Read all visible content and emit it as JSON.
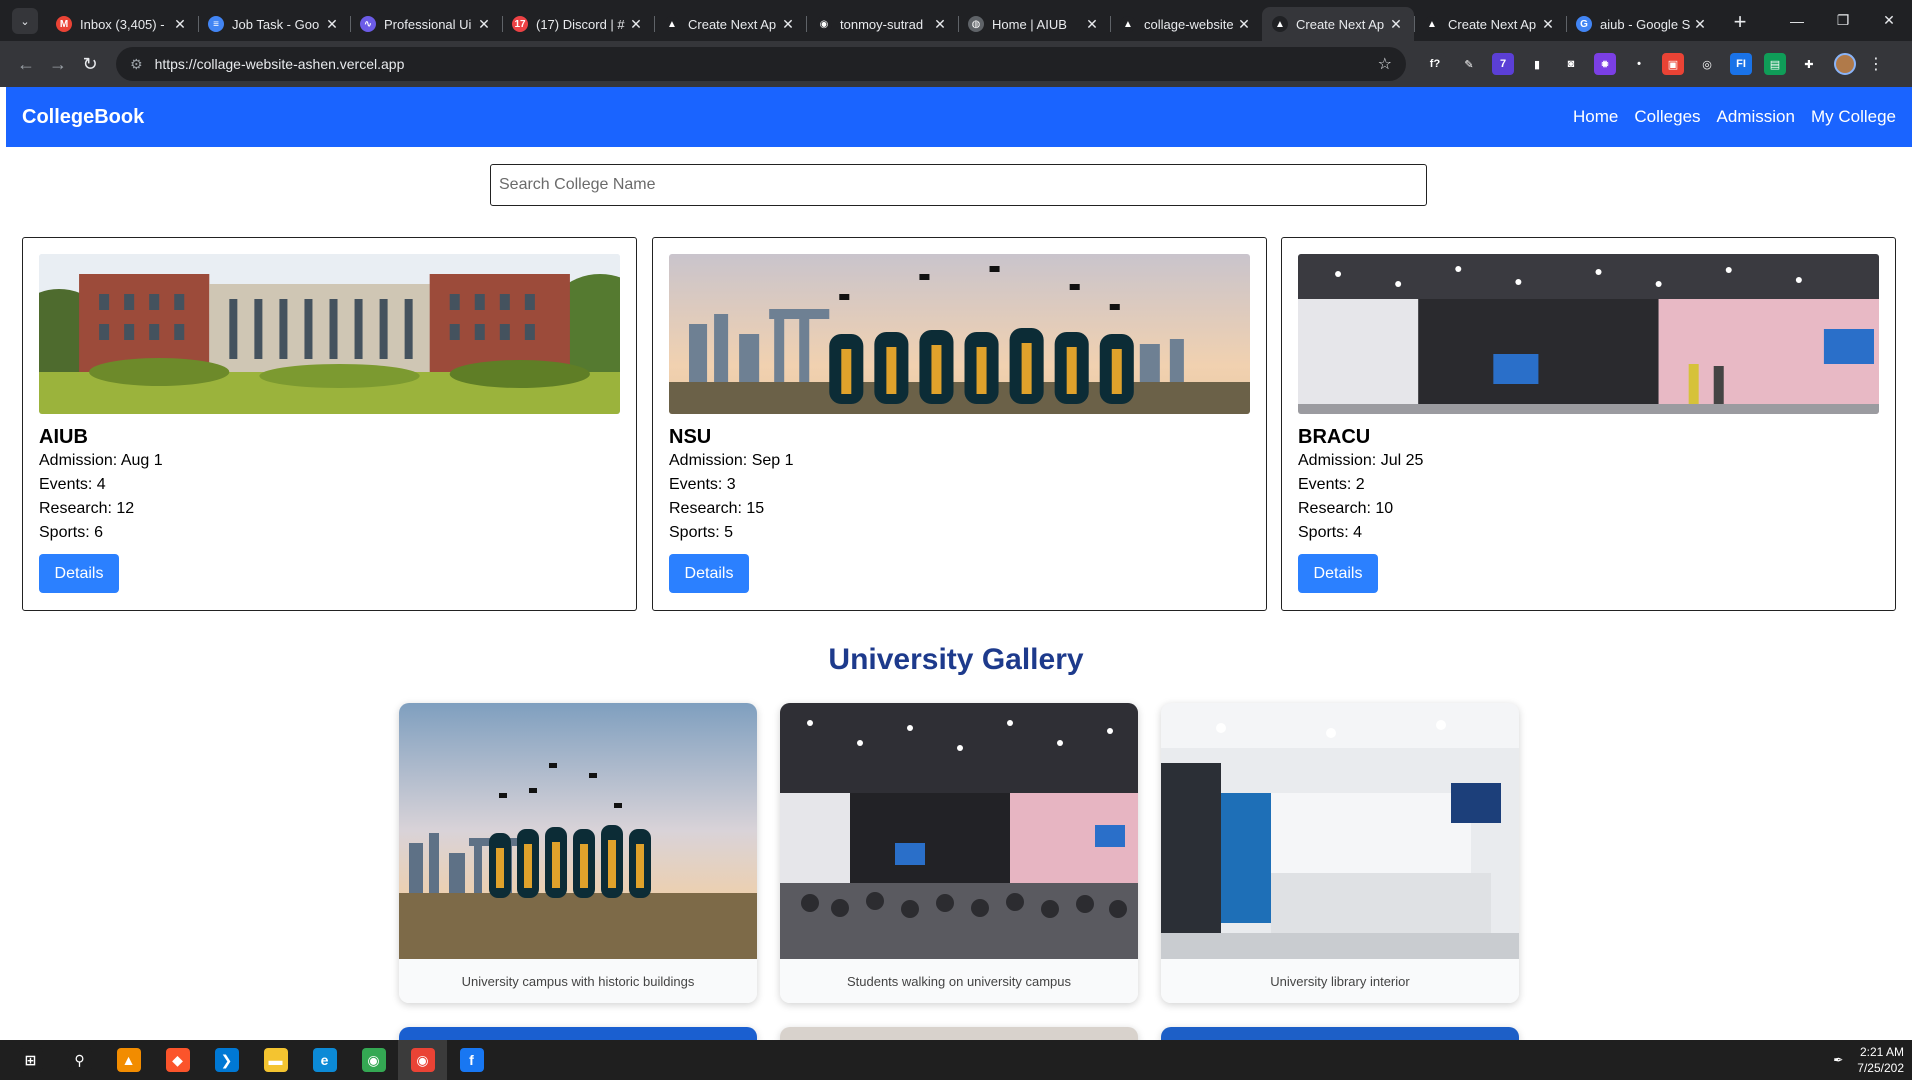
{
  "browser": {
    "tabs": [
      {
        "title": "Inbox (3,405) - ",
        "icon": "gmail-icon",
        "color": "#ea4335",
        "glyph": "M"
      },
      {
        "title": "Job Task - Goo",
        "icon": "docs-icon",
        "color": "#4285f4",
        "glyph": "≡"
      },
      {
        "title": "Professional Ui",
        "icon": "app-icon",
        "color": "#6c5ce7",
        "glyph": "∿"
      },
      {
        "title": "(17) Discord | #",
        "icon": "discord-icon",
        "color": "#ed4245",
        "glyph": "17"
      },
      {
        "title": "Create Next Ap",
        "icon": "vercel-icon",
        "color": "#202124",
        "glyph": "▲"
      },
      {
        "title": "tonmoy-sutrad",
        "icon": "github-icon",
        "color": "#202124",
        "glyph": "◉"
      },
      {
        "title": "Home | AIUB",
        "icon": "globe-icon",
        "color": "#5f6368",
        "glyph": "◍"
      },
      {
        "title": "collage-website",
        "icon": "vercel-icon",
        "color": "#202124",
        "glyph": "▲"
      },
      {
        "title": "Create Next Ap",
        "icon": "vercel-icon",
        "color": "#202124",
        "glyph": "▲",
        "active": true
      },
      {
        "title": "Create Next Ap",
        "icon": "vercel-icon",
        "color": "#202124",
        "glyph": "▲"
      },
      {
        "title": "aiub - Google S",
        "icon": "google-icon",
        "color": "#4285f4",
        "glyph": "G"
      }
    ],
    "url": "https://collage-website-ashen.vercel.app",
    "extensions": [
      {
        "icon": "font-icon",
        "color": "#35363a",
        "glyph": "f?"
      },
      {
        "icon": "eyedropper-icon",
        "color": "#35363a",
        "glyph": "✎"
      },
      {
        "icon": "extension-badge-icon",
        "color": "#5b3fd6",
        "glyph": "7"
      },
      {
        "icon": "note-icon",
        "color": "#35363a",
        "glyph": "▮"
      },
      {
        "icon": "camera-icon",
        "color": "#35363a",
        "glyph": "◙"
      },
      {
        "icon": "gear-extension-icon",
        "color": "#7b3fe4",
        "glyph": "✹"
      },
      {
        "icon": "dropper-icon",
        "color": "#35363a",
        "glyph": "•"
      },
      {
        "icon": "media-icon",
        "color": "#ea4335",
        "glyph": "▣"
      },
      {
        "icon": "eye-icon",
        "color": "#35363a",
        "glyph": "◎"
      },
      {
        "icon": "fi-icon",
        "color": "#1a73e8",
        "glyph": "FI"
      },
      {
        "icon": "sheet-icon",
        "color": "#0f9d58",
        "glyph": "▤"
      },
      {
        "icon": "puzzle-icon",
        "color": "#35363a",
        "glyph": "✚"
      }
    ]
  },
  "site": {
    "brand": "CollegeBook",
    "nav": [
      "Home",
      "Colleges",
      "Admission",
      "My College"
    ],
    "search_placeholder": "Search College Name",
    "colleges": [
      {
        "name": "AIUB",
        "admission": "Admission: Aug 1",
        "events": "Events: 4",
        "research": "Research: 12",
        "sports": "Sports: 6",
        "button": "Details",
        "photo": "campus-building-photo"
      },
      {
        "name": "NSU",
        "admission": "Admission: Sep 1",
        "events": "Events: 3",
        "research": "Research: 15",
        "sports": "Sports: 5",
        "button": "Details",
        "photo": "graduates-photo"
      },
      {
        "name": "BRACU",
        "admission": "Admission: Jul 25",
        "events": "Events: 2",
        "research": "Research: 10",
        "sports": "Sports: 4",
        "button": "Details",
        "photo": "event-hall-photo"
      }
    ],
    "gallery": {
      "title": "University Gallery",
      "items": [
        {
          "caption": "University campus with historic buildings",
          "photo": "graduates-photo"
        },
        {
          "caption": "Students walking on university campus",
          "photo": "hall-audience-photo"
        },
        {
          "caption": "University library interior",
          "photo": "reception-desk-photo"
        }
      ]
    }
  },
  "taskbar": {
    "apps": [
      {
        "icon": "windows-start-icon",
        "color": "#1f1f1f",
        "glyph": "⊞"
      },
      {
        "icon": "search-icon",
        "color": "#1f1f1f",
        "glyph": "⚲"
      },
      {
        "icon": "vlc-icon",
        "color": "#f28c00",
        "glyph": "▲"
      },
      {
        "icon": "brave-icon",
        "color": "#fb542b",
        "glyph": "◆"
      },
      {
        "icon": "vscode-icon",
        "color": "#0078d4",
        "glyph": "❯"
      },
      {
        "icon": "file-explorer-icon",
        "color": "#f4c430",
        "glyph": "▬"
      },
      {
        "icon": "edge-icon",
        "color": "#0c8ad6",
        "glyph": "e"
      },
      {
        "icon": "chrome-icon",
        "color": "#34a853",
        "glyph": "◉"
      },
      {
        "icon": "chrome-icon",
        "color": "#ea4335",
        "glyph": "◉",
        "active": true
      },
      {
        "icon": "facebook-icon",
        "color": "#1877f2",
        "glyph": "f"
      }
    ],
    "time": "2:21 AM",
    "date": "7/25/202"
  }
}
